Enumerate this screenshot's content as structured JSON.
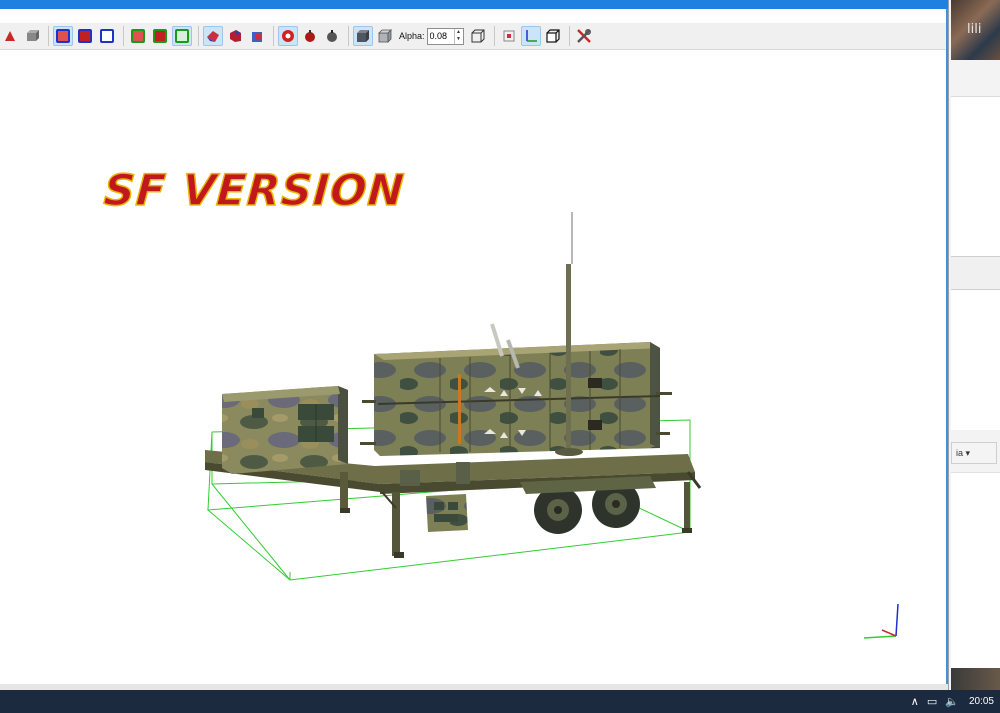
{
  "toolbar": {
    "alpha_label": "Alpha:",
    "alpha_value": "0.08"
  },
  "viewport": {
    "overlay_title": "SF VERSION"
  },
  "right_window": {
    "thumb_label": "lili",
    "dropdown_label": "ia ▾"
  },
  "taskbar": {
    "clock": "20:05"
  },
  "colors": {
    "title_bar": "#1f80e0",
    "taskbar": "#1c2a3f",
    "title_text": "#c0181c",
    "title_outline": "#e8b600",
    "bbox": "#33cc33"
  }
}
